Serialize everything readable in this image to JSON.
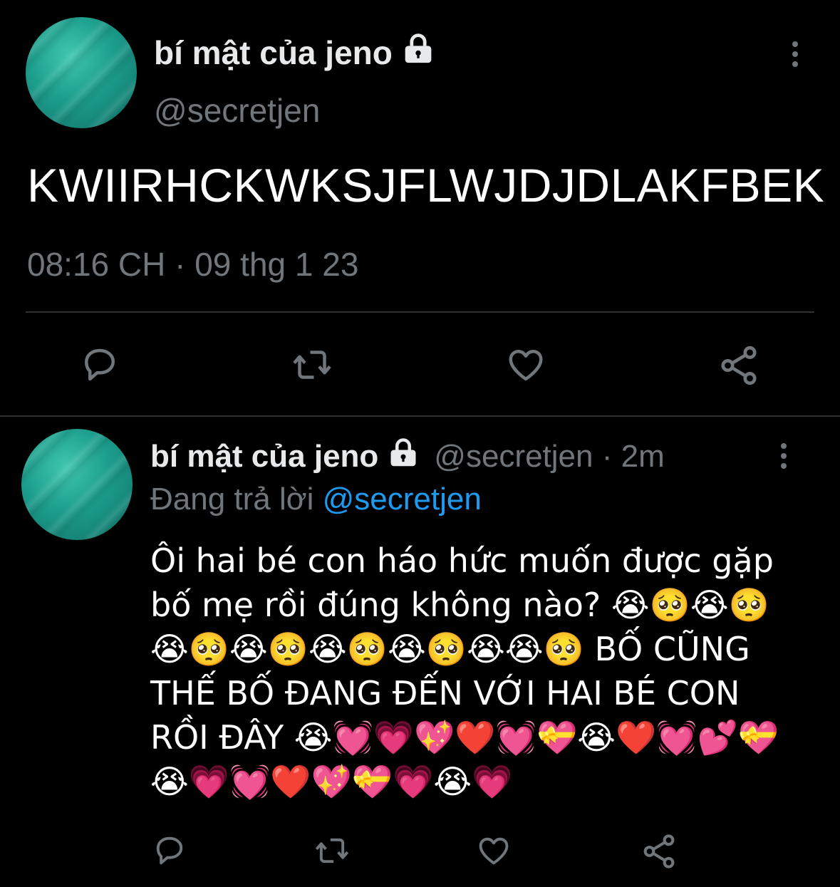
{
  "main_tweet": {
    "display_name": "bí mật của jeno",
    "handle": "@secretjen",
    "text": "KWIIRHCKWKSJFLWJDJDLAKFBEK",
    "timestamp": "08:16 CH · 09 thg 1 23",
    "icons": {
      "lock": "lock-icon",
      "more": "more-vertical-icon",
      "reply": "reply-icon",
      "retweet": "retweet-icon",
      "like": "heart-icon",
      "share": "share-icon"
    }
  },
  "reply_tweet": {
    "display_name": "bí mật của jeno",
    "handle_time": "@secretjen · 2m",
    "replying_prefix": "Đang trả lời",
    "replying_mention": "@secretjen",
    "text": "Ôi hai bé con háo hức muốn được gặp bố mẹ rồi đúng không nào? 😭🥺😭🥺😭🥺😭🥺😭🥺😭🥺😭😭🥺 BỐ CŨNG THẾ BỐ ĐANG ĐẾN VỚI HAI BÉ CON RỒI ĐÂY 😭💓💗💖❤️💓💝😭❤️💓💕💝😭💗💓❤️💖💝💗😭💗"
  },
  "colors": {
    "background": "#000000",
    "primary_text": "#e7e9ea",
    "secondary_text": "#71767b",
    "accent": "#1d9bf0",
    "divider": "#2f3336",
    "avatar": "#1c9d8c"
  }
}
